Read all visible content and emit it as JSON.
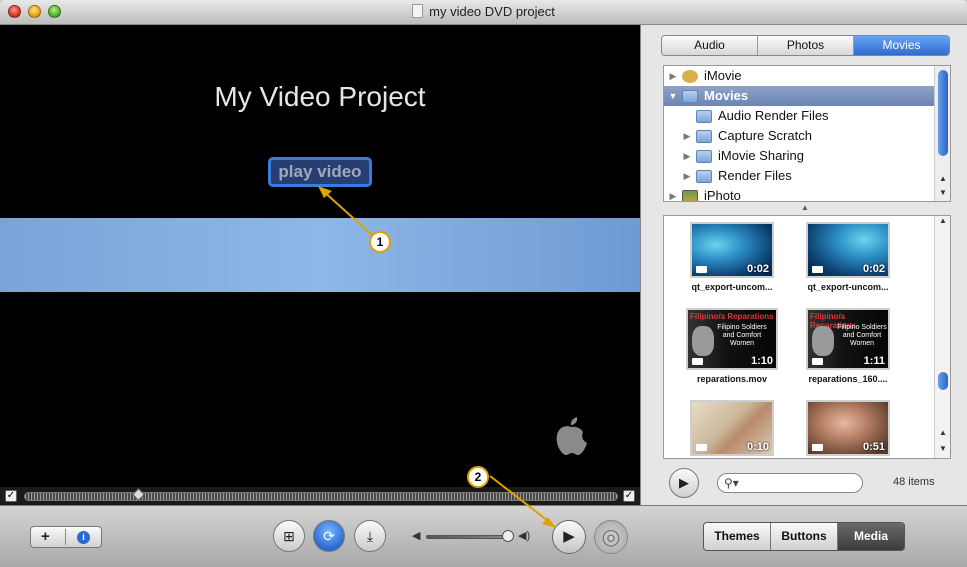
{
  "window": {
    "title": "my video DVD project"
  },
  "preview": {
    "project_title": "My Video Project",
    "play_button_label": "play video",
    "callouts": [
      "1",
      "2"
    ]
  },
  "media_browser": {
    "tabs": [
      {
        "label": "Audio",
        "active": false
      },
      {
        "label": "Photos",
        "active": false
      },
      {
        "label": "Movies",
        "active": true
      }
    ],
    "tree": [
      {
        "label": "iMovie",
        "expanded": false,
        "selected": false,
        "indent": 0,
        "icon": "imovie-icon"
      },
      {
        "label": "Movies",
        "expanded": true,
        "selected": true,
        "indent": 0,
        "icon": "movies-folder-icon"
      },
      {
        "label": "Audio Render Files",
        "expanded": false,
        "selected": false,
        "indent": 1,
        "icon": "folder-icon"
      },
      {
        "label": "Capture Scratch",
        "expanded": false,
        "selected": false,
        "indent": 1,
        "icon": "folder-icon"
      },
      {
        "label": "iMovie Sharing",
        "expanded": false,
        "selected": false,
        "indent": 1,
        "icon": "folder-icon"
      },
      {
        "label": "Render Files",
        "expanded": false,
        "selected": false,
        "indent": 1,
        "icon": "folder-icon"
      },
      {
        "label": "iPhoto",
        "expanded": false,
        "selected": false,
        "indent": 0,
        "icon": "iphoto-icon"
      }
    ],
    "items": [
      {
        "label": "qt_export-uncom...",
        "duration": "0:02"
      },
      {
        "label": "qt_export-uncom...",
        "duration": "0:02"
      },
      {
        "label": "reparations.mov",
        "duration": "1:10",
        "thumb_title": "Filipino/a Reparations",
        "thumb_subtitle": "Filipino Soldiers and Comfort Women"
      },
      {
        "label": "reparations_160....",
        "duration": "1:11",
        "thumb_title": "Filipino/a Reparations",
        "thumb_subtitle": "Filipino Soldiers and Comfort Women"
      },
      {
        "label": "",
        "duration": "0:10"
      },
      {
        "label": "",
        "duration": "0:51"
      }
    ],
    "search": {
      "value": "",
      "placeholder": ""
    },
    "item_count": "48 items"
  },
  "toolbar": {
    "add_label": "+",
    "info_label": "i",
    "mode_buttons": [
      {
        "label": "Themes",
        "active": false
      },
      {
        "label": "Buttons",
        "active": false
      },
      {
        "label": "Media",
        "active": true
      }
    ]
  },
  "colors": {
    "selection_blue": "#2e6bd0",
    "play_button_border": "#3a7be0",
    "callout_border": "#e0a000"
  }
}
